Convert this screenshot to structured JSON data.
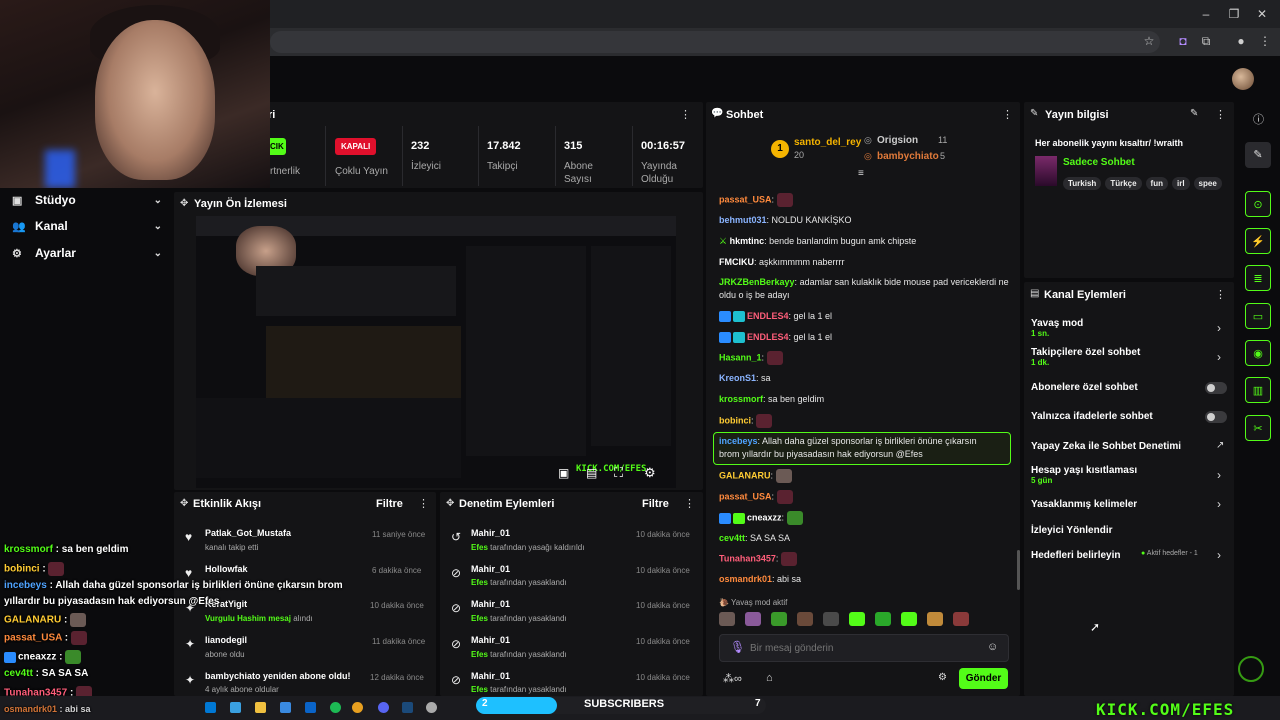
{
  "colors": {
    "accent": "#53fc18",
    "live_red": "#e0102c",
    "bg": "#0b0b0d",
    "panel": "#141416"
  },
  "sidebar": {
    "items": [
      {
        "label": "Stüdyo",
        "icon": "dashboard-icon"
      },
      {
        "label": "Kanal",
        "icon": "users-icon"
      },
      {
        "label": "Ayarlar",
        "icon": "gear-icon"
      }
    ]
  },
  "stream_info_panel": {
    "partial_title": "ri",
    "partner_label_fragment": "rtnerlik",
    "partner_badge_fragment": "CIK",
    "stats": [
      {
        "badge": "KAPALI",
        "label": "Çoklu Yayın"
      },
      {
        "value": "232",
        "label": "İzleyici"
      },
      {
        "value": "17.842",
        "label": "Takipçi"
      },
      {
        "value": "315",
        "label": "Abone Sayısı"
      },
      {
        "value": "00:16:57",
        "label": "Yayında Olduğu"
      }
    ]
  },
  "preview_panel": {
    "title": "Yayın Ön İzlemesi"
  },
  "activity_feed": {
    "title": "Etkinlik Akışı",
    "filter_label": "Filtre",
    "items": [
      {
        "name": "Patlak_Got_Mustafa",
        "sub": "kanalı takip etti",
        "time": "11 saniye önce",
        "icon": "heart-icon"
      },
      {
        "name": "Hollowfak",
        "sub": "",
        "time": "6 dakika önce",
        "icon": "heart-icon"
      },
      {
        "name": "KeratYigit",
        "sub_highlight": "Vurgulu Hashim mesaj",
        "sub": "alındı",
        "time": "10 dakika önce",
        "icon": "sparkle-icon"
      },
      {
        "name": "lianodegil",
        "sub": "abone oldu",
        "time": "11 dakika önce",
        "icon": "sparkle-icon"
      },
      {
        "name": "bambychiato yeniden abone oldu!",
        "sub": "4 aylık abone oldular",
        "time": "12 dakika önce",
        "icon": "sparkle-icon"
      }
    ]
  },
  "moderation_feed": {
    "title": "Denetim Eylemleri",
    "filter_label": "Filtre",
    "items": [
      {
        "name": "Mahir_01",
        "actor": "Efes",
        "action": "tarafından yasağı kaldırıldı",
        "time": "10 dakika önce",
        "icon": "undo-icon"
      },
      {
        "name": "Mahir_01",
        "actor": "Efes",
        "action": "tarafından yasaklandı",
        "time": "10 dakika önce",
        "icon": "ban-icon"
      },
      {
        "name": "Mahir_01",
        "actor": "Efes",
        "action": "tarafından yasaklandı",
        "time": "10 dakika önce",
        "icon": "ban-icon"
      },
      {
        "name": "Mahir_01",
        "actor": "Efes",
        "action": "tarafından yasaklandı",
        "time": "10 dakika önce",
        "icon": "ban-icon"
      },
      {
        "name": "Mahir_01",
        "actor": "Efes",
        "action": "tarafından yasaklandı",
        "time": "10 dakika önce",
        "icon": "ban-icon"
      }
    ]
  },
  "chat": {
    "title": "Sohbet",
    "leaders": [
      {
        "rank": "1",
        "name": "santo_del_rey",
        "count": "20"
      },
      {
        "name": "Origsion",
        "count": "11"
      },
      {
        "name": "bambychiato",
        "count": "5"
      }
    ],
    "messages": [
      {
        "user": "passat_USA",
        "color": "#ff8a3d",
        "text": ""
      },
      {
        "user": "behmut031",
        "color": "#8ab4ff",
        "text": "NOLDU KANKİŞKO"
      },
      {
        "user": "hkmtinc",
        "color": "#ffffff",
        "text": "bende banlandim bugun amk chipste"
      },
      {
        "user": "FMCIKU",
        "color": "#ffffff",
        "text": "aşkkımmmm naberrrr"
      },
      {
        "user": "JRKZBenBerkayy",
        "color": "#53fc18",
        "text": "adamlar san kulaklık bide mouse pad vericeklerdi ne oldu o iş be adayı"
      },
      {
        "user": "ENDLES4",
        "color": "#ff5e7a",
        "text": "gel la 1 el"
      },
      {
        "user": "ENDLES4",
        "color": "#ff5e7a",
        "text": "gel la 1 el"
      },
      {
        "user": "Hasann_1",
        "color": "#53fc18",
        "text": ""
      },
      {
        "user": "KreonS1",
        "color": "#8ab4ff",
        "text": "sa"
      },
      {
        "user": "krossmorf",
        "color": "#53fc18",
        "text": "sa ben geldim"
      },
      {
        "user": "bobinci",
        "color": "#ffcc33",
        "text": ""
      },
      {
        "user": "incebeys",
        "color": "#4fa3ff",
        "text": "Allah daha güzel sponsorlar iş birlikleri önüne çıkarsın brom yıllardır bu piyasadasın hak ediyorsun @Efes"
      },
      {
        "user": "GALANARU",
        "color": "#ffcc33",
        "text": ""
      },
      {
        "user": "passat_USA",
        "color": "#ff8a3d",
        "text": ""
      },
      {
        "user": "cneaxzz",
        "color": "#ffffff",
        "text": ""
      },
      {
        "user": "cev4tt",
        "color": "#53fc18",
        "text": "SA SA SA"
      },
      {
        "user": "Tunahan3457",
        "color": "#ff5e7a",
        "text": ""
      },
      {
        "user": "osmandrk01",
        "color": "#ff8a3d",
        "text": "abi sa"
      }
    ],
    "slow_mode_notice": "Yavaş mod aktif",
    "input_placeholder": "Bir mesaj gönderin",
    "send_label": "Gönder"
  },
  "stream_info": {
    "title": "Yayın bilgisi",
    "stream_title": "Her abonelik yayını kısaltır/ !wraith",
    "category": "Sadece Sohbet",
    "tags": [
      "Turkish",
      "Türkçe",
      "fun",
      "irl",
      "spee"
    ]
  },
  "channel_actions": {
    "title": "Kanal Eylemleri",
    "items": [
      {
        "label": "Yavaş mod",
        "sub": "1 sn.",
        "control": "chevron"
      },
      {
        "label": "Takipçilere özel sohbet",
        "sub": "1 dk.",
        "control": "chevron"
      },
      {
        "label": "Abonelere özel sohbet",
        "sub": "",
        "control": "toggle"
      },
      {
        "label": "Yalnızca ifadelerle sohbet",
        "sub": "",
        "control": "toggle"
      },
      {
        "label": "Yapay Zeka ile Sohbet Denetimi",
        "sub": "",
        "control": "external"
      },
      {
        "label": "Hesap yaşı kısıtlaması",
        "sub": "5 gün",
        "control": "chevron"
      },
      {
        "label": "Yasaklanmış kelimeler",
        "sub": "",
        "control": "chevron"
      },
      {
        "label": "İzleyici Yönlendir",
        "sub": "",
        "control": "none"
      },
      {
        "label": "Hedefleri belirleyin",
        "sub": "",
        "extra": "Aktif hedefler - 1",
        "control": "chevron"
      }
    ]
  },
  "overlay_chat": [
    {
      "user": "krossmorf",
      "color": "#53fc18",
      "text": "sa ben geldim"
    },
    {
      "user": "bobinci",
      "color": "#ffcc33",
      "text": ""
    },
    {
      "user": "incebeys",
      "color": "#4fa3ff",
      "text": "Allah daha güzel sponsorlar iş birlikleri önüne çıkarsın brom"
    },
    {
      "user": "",
      "color": "#ffffff",
      "text": "yıllardır bu piyasadasın hak ediyorsun @Efes"
    },
    {
      "user": "GALANARU",
      "color": "#ffcc33",
      "text": ""
    },
    {
      "user": "passat_USA",
      "color": "#ff8a3d",
      "text": ""
    },
    {
      "user": "cneaxzz",
      "color": "#ffffff",
      "text": ""
    },
    {
      "user": "cev4tt",
      "color": "#53fc18",
      "text": "SA SA SA"
    },
    {
      "user": "Tunahan3457",
      "color": "#ff5e7a",
      "text": ""
    },
    {
      "user": "osmandrk01",
      "color": "#ff8a3d",
      "text": "abi sa"
    }
  ],
  "subs_bar": {
    "current": "2",
    "label": "SUBSCRIBERS",
    "goal": "7",
    "progress_fraction": 0.28
  },
  "brand_url": "KICK.COM/EFES"
}
